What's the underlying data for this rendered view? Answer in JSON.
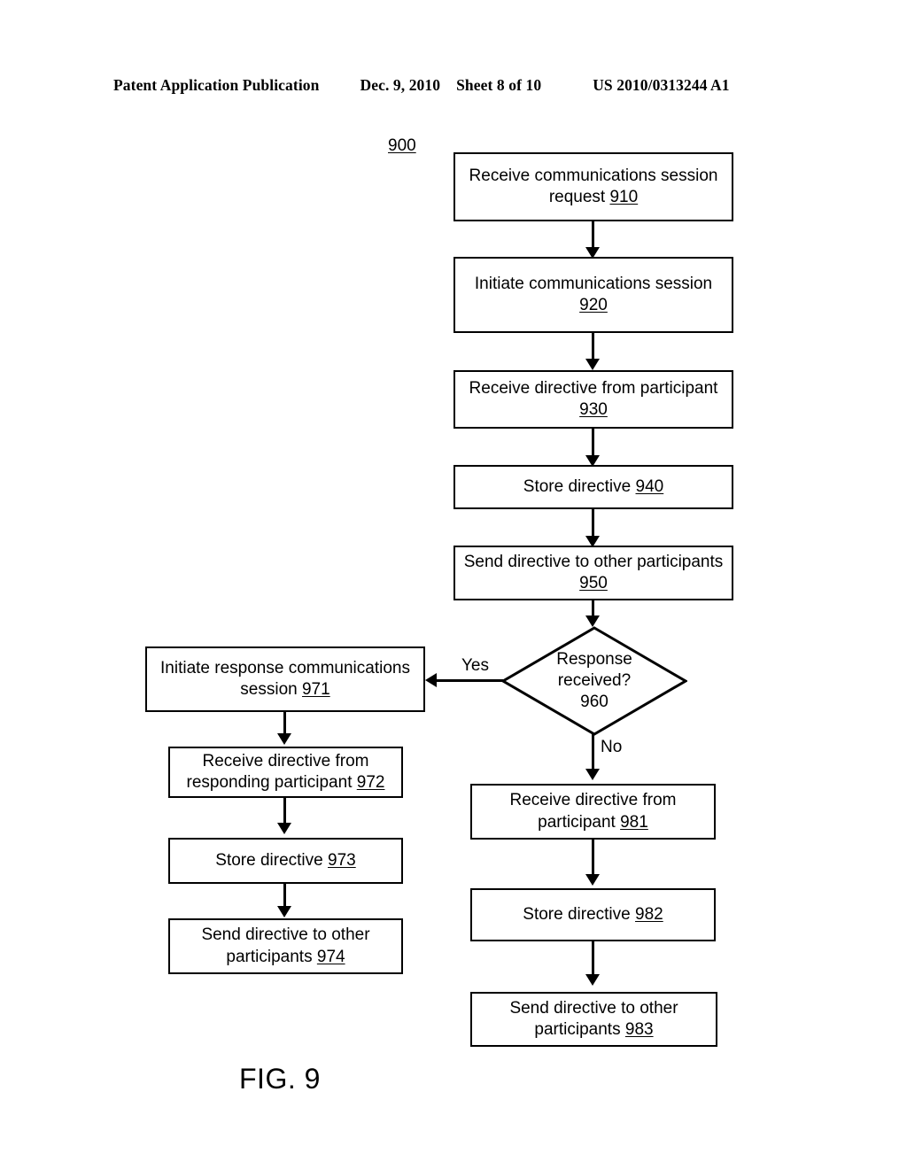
{
  "header": {
    "publication": "Patent Application Publication",
    "date": "Dec. 9, 2010",
    "sheet": "Sheet 8 of 10",
    "patent_number": "US 2010/0313244 A1"
  },
  "figure": {
    "caption": "FIG. 9",
    "diagram_ref": "900"
  },
  "flowchart": {
    "nodes": [
      {
        "id": "910",
        "line1": "Receive communications session",
        "line2": "request ",
        "num": "910"
      },
      {
        "id": "920",
        "line1": "Initiate communications session",
        "line2": "",
        "num": "920"
      },
      {
        "id": "930",
        "line1": "Receive directive from participant",
        "line2": "",
        "num": "930"
      },
      {
        "id": "940",
        "line1": "Store directive ",
        "line2": "",
        "num": "940"
      },
      {
        "id": "950",
        "line1": "Send directive to other participants",
        "line2": "",
        "num": "950"
      },
      {
        "id": "960",
        "line1": "Response",
        "line2": "received?",
        "num": "960"
      },
      {
        "id": "971",
        "line1": "Initiate response communications",
        "line2": "session ",
        "num": "971"
      },
      {
        "id": "972",
        "line1": "Receive directive from",
        "line2": "responding participant ",
        "num": "972"
      },
      {
        "id": "973",
        "line1": "Store directive ",
        "line2": "",
        "num": "973"
      },
      {
        "id": "974",
        "line1": "Send directive to other",
        "line2": "participants ",
        "num": "974"
      },
      {
        "id": "981",
        "line1": "Receive directive from",
        "line2": "participant ",
        "num": "981"
      },
      {
        "id": "982",
        "line1": "Store directive ",
        "line2": "",
        "num": "982"
      },
      {
        "id": "983",
        "line1": "Send directive to other",
        "line2": "participants ",
        "num": "983"
      }
    ],
    "branch_labels": {
      "yes": "Yes",
      "no": "No"
    }
  }
}
